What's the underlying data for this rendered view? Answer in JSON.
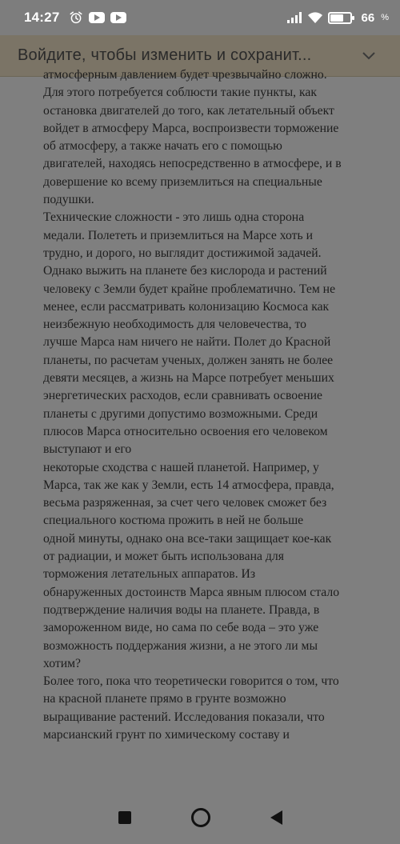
{
  "status": {
    "time": "14:27",
    "battery": "66",
    "battery_unit": "%"
  },
  "banner": {
    "text": "Войдите, чтобы изменить и сохранит..."
  },
  "article": {
    "lines": [
      "атмосферным давлением будет чрезвычайно сложно.",
      "Для этого потребуется соблюсти такие пункты, как",
      "остановка двигателей до того, как летательный объект",
      "войдет в атмосферу Марса, воспроизвести торможение",
      "об атмосферу, а также начать его с помощью",
      "двигателей, находясь непосредственно в атмосфере, и в",
      "довершение ко всему приземлиться на специальные",
      "подушки.",
      "Технические сложности - это лишь одна сторона",
      "медали. Полететь и приземлиться на Марсе хоть и",
      "трудно, и дорого, но выглядит достижимой задачей.",
      "Однако выжить на планете без кислорода и растений",
      "человеку с Земли будет крайне проблематично. Тем не",
      "менее, если рассматривать колонизацию Космоса как",
      "неизбежную необходимость для человечества, то",
      "лучше Марса нам ничего не найти. Полет до Красной",
      "планеты, по расчетам ученых, должен занять не более",
      "девяти месяцев, а жизнь на Марсе потребует меньших",
      "энергетических расходов, если сравнивать освоение",
      "планеты с другими допустимо возможными. Среди",
      "плюсов Марса относительно освоения его человеком",
      "выступают и его",
      "некоторые сходства с нашей планетой. Например, у",
      "Марса, так же как у Земли, есть 14 атмосфера, правда,",
      "весьма разряженная, за счет чего человек сможет без",
      "специального костюма прожить в ней не больше",
      "одной минуты, однако она все-таки защищает кое-как",
      "от радиации, и может быть использована для",
      "торможения летательных аппаратов. Из",
      "обнаруженных достоинств Марса явным плюсом стало",
      "подтверждение наличия воды на планете. Правда, в",
      "замороженном виде, но сама по себе вода – это уже",
      "возможность поддержания жизни, а не этого ли мы",
      "хотим?",
      "Более того, пока что теоретически говорится о том, что",
      "на красной планете прямо в грунте возможно",
      "выращивание растений. Исследования показали, что",
      "марсианский грунт по химическому составу и"
    ]
  },
  "icons": {
    "alarm": "alarm-clock-icon",
    "youtube": "youtube-icon",
    "signal": "signal-icon",
    "wifi": "wifi-icon",
    "battery": "battery-icon",
    "chevron": "chevron-down-icon",
    "nav_recent": "recent-apps-icon",
    "nav_home": "home-icon",
    "nav_back": "back-icon"
  }
}
